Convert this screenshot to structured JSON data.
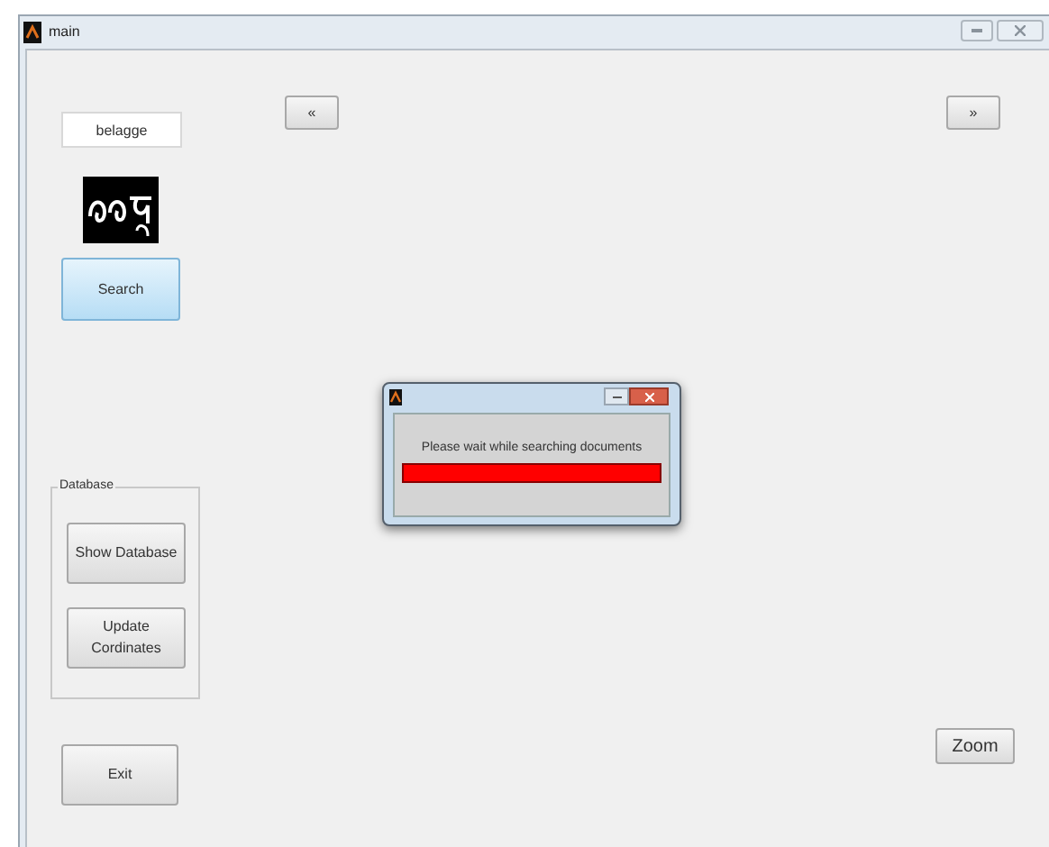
{
  "window": {
    "title": "main"
  },
  "query_field": {
    "value": "belagge"
  },
  "search_button": "Search",
  "prev_button": "«",
  "next_button": "»",
  "database_group": {
    "title": "Database",
    "buttons": [
      "Show Database",
      "Update Cordinates"
    ]
  },
  "exit_button": "Exit",
  "zoom_button": "Zoom",
  "progress_dialog": {
    "message": "Please wait while searching documents",
    "level": 1
  }
}
